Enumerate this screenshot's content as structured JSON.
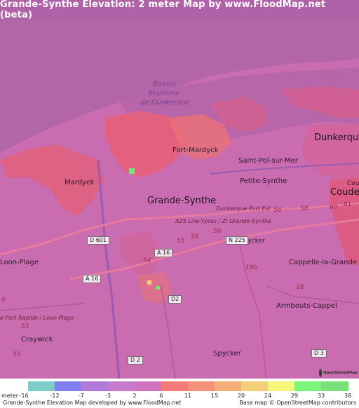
{
  "title": "Grande-Synthe Elevation: 2 meter Map by www.FloodMap.net (beta)",
  "map": {
    "places": {
      "grande_synthe": "Grande-Synthe",
      "fort_mardyck": "Fort-Mardyck",
      "saint_pol": "Saint-Pol-sur-Mer",
      "petite_synthe": "Petite-Synthe",
      "mardyck": "Mardyck",
      "dunkerque": "Dunkerque",
      "coude_1": "Coude",
      "coude_2": "Coude",
      "loon_plage": "Loon-Plage",
      "cappelle": "Cappelle-la-Grande",
      "spycker_road": "Spycker",
      "armbouts": "Armbouts-Cappel",
      "spycker": "Spycker",
      "craywick": "Craywick"
    },
    "water_label": [
      "Bassin",
      "Maritime",
      "de Dunkerque"
    ],
    "road_labels": {
      "port_est": "Dunkerque Port Est",
      "a25": "A25 Lille-Ypres / ZI Grande Synthe",
      "port_rapide": "e Port Rapide / Loon Plage"
    },
    "shields": {
      "d601": "D 601",
      "n225": "N 225",
      "a16_1": "A 16",
      "a16_2": "A 16",
      "d2_1": "D2",
      "d2_2": "D 2",
      "d3": "D 3"
    },
    "route_numbers": {
      "r58a": "58",
      "r58b": "58",
      "r60": "60",
      "r61": "61",
      "r56a": "56",
      "r56b": "56",
      "r55": "55",
      "r54": "54",
      "r19b": "19b",
      "r18": "18",
      "r53a": "53",
      "r53b": "53",
      "r6": "6"
    },
    "osm_logo_text": "OpenStreetMap"
  },
  "legend": {
    "unit_label": "meter",
    "ticks": [
      "-16",
      "-12",
      "-7",
      "-3",
      "2",
      "6",
      "11",
      "15",
      "20",
      "24",
      "29",
      "33",
      "38"
    ],
    "colors": [
      "#7ecbc8",
      "#7f7ff0",
      "#b07ad6",
      "#c57acb",
      "#d073be",
      "#f57a7a",
      "#f5917a",
      "#f5ad7a",
      "#f5d07a",
      "#f5f57a",
      "#7af57a",
      "#7ae07a"
    ]
  },
  "footer": {
    "left": "Grande-Synthe Elevation Map developed by www.FloodMap.net",
    "right": "Base map © OpenStreetMap contributors"
  }
}
